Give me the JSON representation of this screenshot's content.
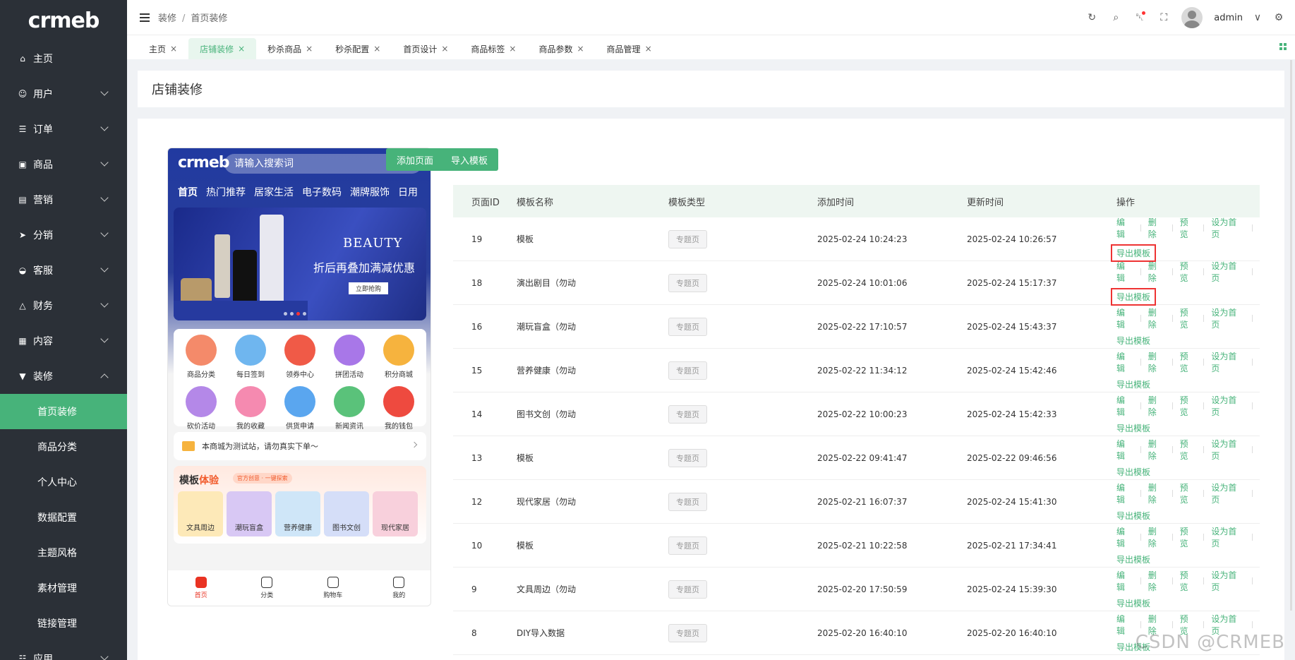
{
  "sidebar": {
    "logo": "crmeb",
    "items": [
      {
        "label": "主页",
        "icon": "home-icon",
        "expand": false
      },
      {
        "label": "用户",
        "icon": "user-icon",
        "expand": true
      },
      {
        "label": "订单",
        "icon": "order-icon",
        "expand": true
      },
      {
        "label": "商品",
        "icon": "goods-icon",
        "expand": true
      },
      {
        "label": "营销",
        "icon": "marketing-icon",
        "expand": true
      },
      {
        "label": "分销",
        "icon": "distribution-icon",
        "expand": true
      },
      {
        "label": "客服",
        "icon": "service-icon",
        "expand": true
      },
      {
        "label": "财务",
        "icon": "finance-icon",
        "expand": true
      },
      {
        "label": "内容",
        "icon": "content-icon",
        "expand": true
      }
    ],
    "decorate": {
      "label": "装修",
      "icon": "decorate-icon",
      "children": [
        "首页装修",
        "商品分类",
        "个人中心",
        "数据配置",
        "主题风格",
        "素材管理",
        "链接管理"
      ]
    },
    "app": {
      "label": "应用",
      "icon": "app-icon"
    }
  },
  "header": {
    "breadcrumb": [
      "装修",
      "首页装修"
    ],
    "user": "admin"
  },
  "tabs": [
    "主页",
    "店铺装修",
    "秒杀商品",
    "秒杀配置",
    "首页设计",
    "商品标签",
    "商品参数",
    "商品管理"
  ],
  "page_title": "店铺装修",
  "phone": {
    "logo": "crmeb",
    "search_placeholder": "请输入搜索词",
    "cats": [
      "首页",
      "热门推荐",
      "居家生活",
      "电子数码",
      "潮牌服饰",
      "日用"
    ],
    "banner_title": "BEAUTY",
    "banner_sub": "折后再叠加满减优惠",
    "banner_btn": "立即抢购",
    "icons": [
      "商品分类",
      "每日签到",
      "领券中心",
      "拼团活动",
      "积分商城",
      "砍价活动",
      "我的收藏",
      "供货申请",
      "新闻资讯",
      "我的钱包"
    ],
    "icon_colors": [
      "#f48a6a",
      "#6fb6ef",
      "#f05a47",
      "#a877e8",
      "#f6b33e",
      "#b488e8",
      "#f58ab0",
      "#5aa6ef",
      "#5ac27a",
      "#ee4a3f"
    ],
    "notice": "本商城为测试站，请勿真实下单～",
    "tpl_title_a": "模板",
    "tpl_title_b": "体验",
    "tpl_tag": "官方创意 · 一键探索",
    "tpl_cards": [
      "文具周边",
      "潮玩盲盒",
      "营养健康",
      "图书文创",
      "现代家居"
    ],
    "tpl_colors": [
      "#fde9b8",
      "#d8c8f4",
      "#cfe6f8",
      "#d5def8",
      "#f8d0dc"
    ],
    "nav": [
      "首页",
      "分类",
      "购物车",
      "我的"
    ]
  },
  "buttons": {
    "add": "添加页面",
    "import": "导入模板"
  },
  "table": {
    "headers": [
      "页面ID",
      "模板名称",
      "模板类型",
      "添加时间",
      "更新时间",
      "操作"
    ],
    "ops": {
      "edit": "编辑",
      "del": "删除",
      "preview": "预览",
      "set_home": "设为首页",
      "export": "导出模板"
    },
    "rows": [
      {
        "id": "19",
        "name": "模板",
        "type": "专题页",
        "added": "2025-02-24 10:24:23",
        "updated": "2025-02-24 10:26:57",
        "hl": true
      },
      {
        "id": "18",
        "name": "演出剧目（勿动",
        "type": "专题页",
        "added": "2025-02-24 10:01:06",
        "updated": "2025-02-24 15:17:37",
        "hl": true
      },
      {
        "id": "16",
        "name": "潮玩盲盒（勿动",
        "type": "专题页",
        "added": "2025-02-22 17:10:57",
        "updated": "2025-02-24 15:43:37",
        "hl": false
      },
      {
        "id": "15",
        "name": "营养健康（勿动",
        "type": "专题页",
        "added": "2025-02-22 11:34:12",
        "updated": "2025-02-24 15:42:46",
        "hl": false
      },
      {
        "id": "14",
        "name": "图书文创（勿动",
        "type": "专题页",
        "added": "2025-02-22 10:00:23",
        "updated": "2025-02-24 15:42:33",
        "hl": false
      },
      {
        "id": "13",
        "name": "模板",
        "type": "专题页",
        "added": "2025-02-22 09:41:47",
        "updated": "2025-02-22 09:46:56",
        "hl": false
      },
      {
        "id": "12",
        "name": "现代家居（勿动",
        "type": "专题页",
        "added": "2025-02-21 16:07:37",
        "updated": "2025-02-24 15:41:30",
        "hl": false
      },
      {
        "id": "10",
        "name": "模板",
        "type": "专题页",
        "added": "2025-02-21 10:22:58",
        "updated": "2025-02-21 17:34:41",
        "hl": false
      },
      {
        "id": "9",
        "name": "文具周边（勿动",
        "type": "专题页",
        "added": "2025-02-20 17:50:59",
        "updated": "2025-02-24 15:39:30",
        "hl": false
      },
      {
        "id": "8",
        "name": "DIY导入数据",
        "type": "专题页",
        "added": "2025-02-20 16:40:10",
        "updated": "2025-02-20 16:40:10",
        "hl": false
      }
    ]
  },
  "watermark": "CSDN @CRMEB"
}
